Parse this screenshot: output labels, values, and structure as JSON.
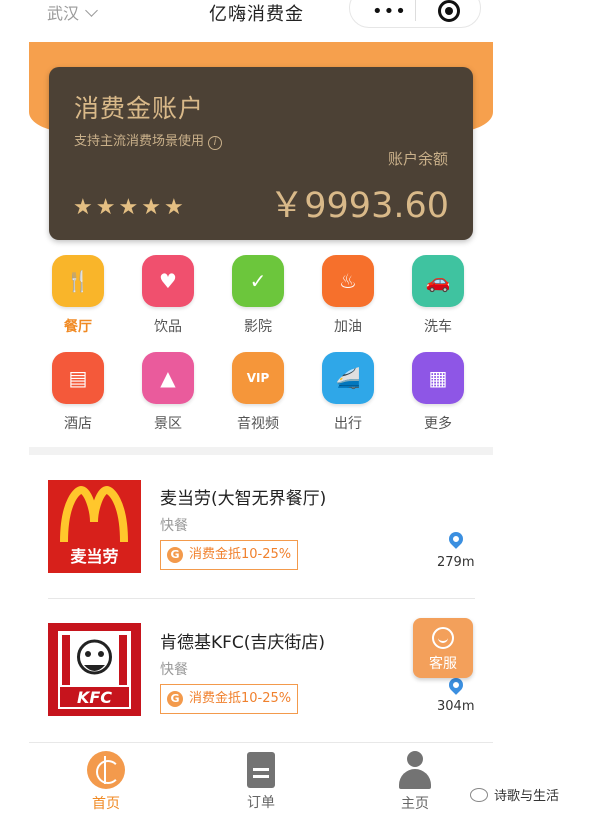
{
  "topbar": {
    "city": "武汉",
    "title": "亿嗨消费金"
  },
  "account": {
    "title": "消费金账户",
    "subtitle": "支持主流消费场景使用",
    "balance_label": "账户余额",
    "balance": "￥9993.60",
    "stars": 5
  },
  "categories": [
    {
      "label": "餐厅",
      "icon": "restaurant-icon",
      "color": "#f9b52a",
      "active": true
    },
    {
      "label": "饮品",
      "icon": "drink-icon",
      "color": "#f0506e",
      "active": false
    },
    {
      "label": "影院",
      "icon": "cinema-icon",
      "color": "#6cc63c",
      "active": false
    },
    {
      "label": "加油",
      "icon": "fuel-icon",
      "color": "#f6702c",
      "active": false
    },
    {
      "label": "洗车",
      "icon": "carwash-icon",
      "color": "#3fc3a0",
      "active": false
    },
    {
      "label": "酒店",
      "icon": "hotel-icon",
      "color": "#f4593a",
      "active": false
    },
    {
      "label": "景区",
      "icon": "scenic-icon",
      "color": "#ea5b9c",
      "active": false
    },
    {
      "label": "音视频",
      "icon": "vip-icon",
      "color": "#f5963a",
      "active": false
    },
    {
      "label": "出行",
      "icon": "train-icon",
      "color": "#2fa7e8",
      "active": false
    },
    {
      "label": "更多",
      "icon": "more-icon",
      "color": "#8e56e6",
      "active": false
    }
  ],
  "stores": [
    {
      "name": "麦当劳(大智无界餐厅)",
      "type": "快餐",
      "tag": "消费金抵10-25%",
      "distance": "279m",
      "logo_text": "麦当劳"
    },
    {
      "name": "肯德基KFC(吉庆街店)",
      "type": "快餐",
      "tag": "消费金抵10-25%",
      "distance": "304m",
      "logo_text": "KFC"
    }
  ],
  "customer_service": "客服",
  "tabs": [
    {
      "label": "首页",
      "icon": "home-coin-icon",
      "active": true
    },
    {
      "label": "订单",
      "icon": "order-doc-icon",
      "active": false
    },
    {
      "label": "主页",
      "icon": "user-icon",
      "active": false
    }
  ],
  "watermark": "诗歌与生活"
}
